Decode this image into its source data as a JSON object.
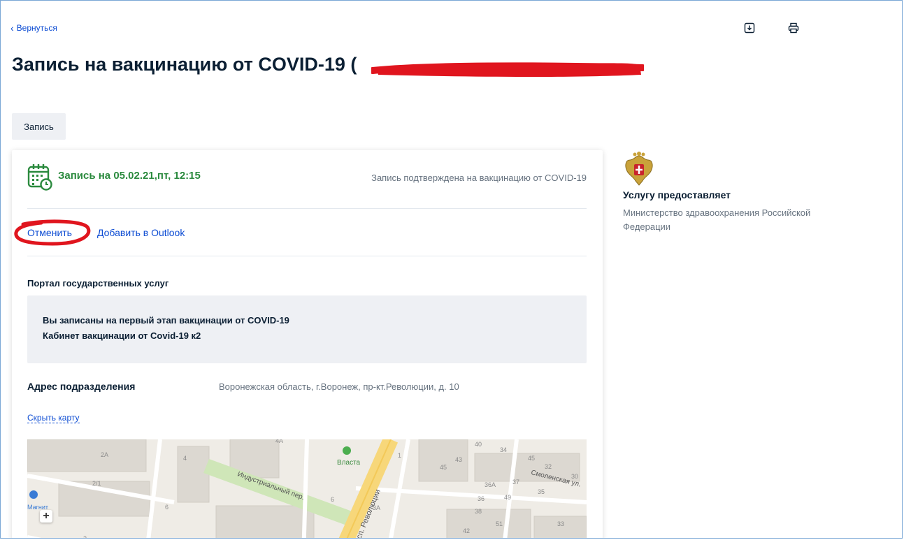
{
  "header": {
    "back_label": "Вернуться",
    "title": "Запись на вакцинацию от COVID-19 (",
    "download_icon": "download-icon",
    "print_icon": "print-icon"
  },
  "tabs": [
    {
      "label": "Запись"
    }
  ],
  "appointment": {
    "icon": "calendar-clock-icon",
    "title": "Запись на 05.02.21,пт, 12:15",
    "status": "Запись подтверждена на вакцинацию от COVID-19",
    "actions": {
      "cancel": "Отменить",
      "outlook": "Добавить в Outlook"
    },
    "portal_label": "Портал государственных услуг",
    "info_lines": [
      "Вы записаны на первый этап вакцинации от COVID-19",
      "Кабинет вакцинации от Covid-19 к2"
    ],
    "address_label": "Адрес подразделения",
    "address_value": "Воронежская область, г.Воронеж, пр-кт.Революции, д. 10",
    "hide_map_label": "Скрыть карту"
  },
  "map": {
    "streets": [
      "Индустриальный пер.",
      "просп. Революции",
      "Смоленская ул."
    ],
    "pois": [
      "Власта",
      "Магнит"
    ],
    "house_numbers": [
      "2А",
      "4",
      "2/1",
      "6",
      "2",
      "4А",
      "6",
      "3А",
      "1",
      "40",
      "34",
      "43",
      "45",
      "45",
      "32",
      "30",
      "36А",
      "37",
      "35",
      "36",
      "49",
      "38",
      "42",
      "51",
      "33"
    ],
    "zoom_in": "+"
  },
  "provider": {
    "emblem_icon": "russian-emblem-icon",
    "title": "Услугу предоставляет",
    "organization": "Министерство здравоохранения Российской Федерации"
  },
  "colors": {
    "accent": "#0d4cd3",
    "success": "#2b8a3e",
    "mark": "#e0151e"
  }
}
